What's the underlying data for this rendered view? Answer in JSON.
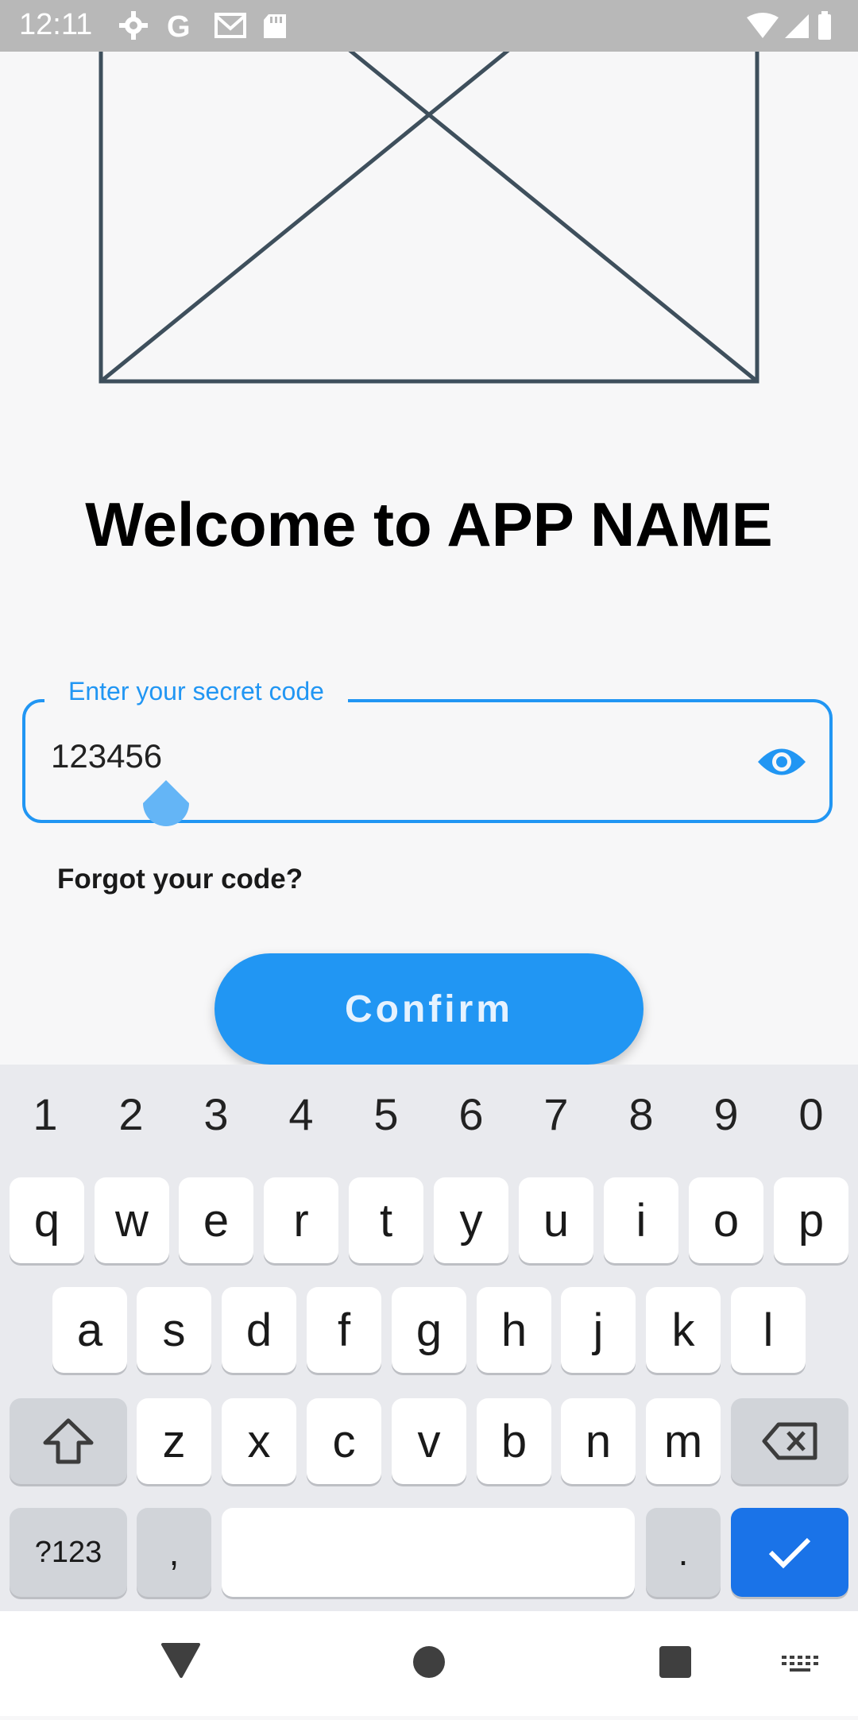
{
  "status_bar": {
    "time": "12:11",
    "icons": [
      "settings-icon",
      "google-icon",
      "gmail-icon",
      "sd-card-icon"
    ],
    "right_icons": [
      "wifi-icon",
      "signal-icon",
      "battery-icon"
    ]
  },
  "title": "Welcome to APP NAME",
  "code_field": {
    "label": "Enter your secret code",
    "value": "123456",
    "toggle_icon": "eye-icon"
  },
  "forgot_link": "Forgot your code?",
  "confirm_label": "Confirm",
  "keyboard": {
    "numbers": [
      "1",
      "2",
      "3",
      "4",
      "5",
      "6",
      "7",
      "8",
      "9",
      "0"
    ],
    "row1": [
      "q",
      "w",
      "e",
      "r",
      "t",
      "y",
      "u",
      "i",
      "o",
      "p"
    ],
    "row2": [
      "a",
      "s",
      "d",
      "f",
      "g",
      "h",
      "j",
      "k",
      "l"
    ],
    "row3": [
      "z",
      "x",
      "c",
      "v",
      "b",
      "n",
      "m"
    ],
    "symbols_label": "?123",
    "comma_label": ",",
    "period_label": "."
  },
  "colors": {
    "accent": "#2196F3",
    "enter_key": "#1A73E8",
    "status_bar": "#B8B8B8"
  }
}
